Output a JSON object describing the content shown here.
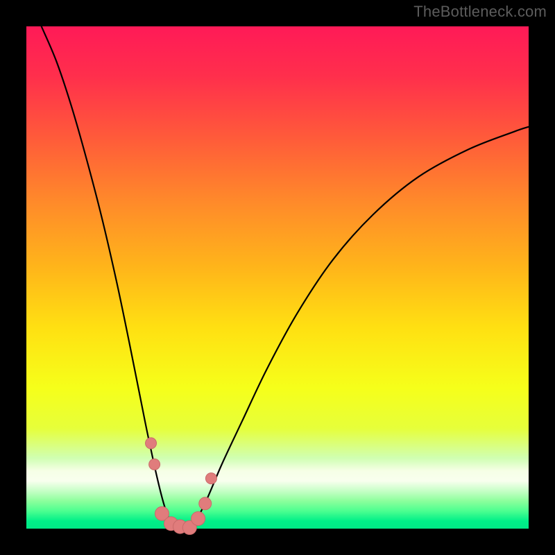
{
  "watermark": "TheBottleneck.com",
  "colors": {
    "frame": "#000000",
    "curve": "#000000",
    "dot_fill": "#e07c7c",
    "dot_stroke": "#c96a6a",
    "gradient_stops": [
      {
        "offset": 0.0,
        "color": "#ff1a57"
      },
      {
        "offset": 0.1,
        "color": "#ff2f4c"
      },
      {
        "offset": 0.22,
        "color": "#ff5a3a"
      },
      {
        "offset": 0.35,
        "color": "#ff8a2a"
      },
      {
        "offset": 0.48,
        "color": "#ffb51a"
      },
      {
        "offset": 0.6,
        "color": "#ffe012"
      },
      {
        "offset": 0.72,
        "color": "#f6ff1a"
      },
      {
        "offset": 0.8,
        "color": "#e6ff3a"
      },
      {
        "offset": 0.86,
        "color": "#d0ffb3"
      },
      {
        "offset": 0.885,
        "color": "#f6ffe6"
      },
      {
        "offset": 0.905,
        "color": "#f8ffee"
      },
      {
        "offset": 0.925,
        "color": "#c6ffc6"
      },
      {
        "offset": 0.945,
        "color": "#8cff9c"
      },
      {
        "offset": 0.965,
        "color": "#4cff90"
      },
      {
        "offset": 0.985,
        "color": "#00ef88"
      },
      {
        "offset": 1.0,
        "color": "#00e886"
      }
    ]
  },
  "chart_data": {
    "type": "line",
    "title": "",
    "xlabel": "",
    "ylabel": "",
    "description": "Two V-shaped bottleneck curves on a red-to-green vertical gradient. Lower y ≈ greener ≈ better. Left curve dips to ~0 near x≈0.28; right curve dips near x≈0.33 then rises shallower than left branch.",
    "xlim": [
      0,
      1
    ],
    "ylim": [
      0,
      1
    ],
    "grid": false,
    "legend": false,
    "series": [
      {
        "name": "left-curve",
        "x": [
          0.03,
          0.06,
          0.09,
          0.12,
          0.15,
          0.18,
          0.205,
          0.225,
          0.24,
          0.255,
          0.268,
          0.278,
          0.286,
          0.293,
          0.3
        ],
        "values": [
          1.0,
          0.93,
          0.84,
          0.735,
          0.62,
          0.49,
          0.37,
          0.27,
          0.195,
          0.125,
          0.07,
          0.035,
          0.015,
          0.003,
          0.0
        ]
      },
      {
        "name": "right-curve",
        "x": [
          0.325,
          0.34,
          0.36,
          0.39,
          0.43,
          0.48,
          0.54,
          0.61,
          0.69,
          0.78,
          0.88,
          0.97,
          1.0
        ],
        "values": [
          0.0,
          0.02,
          0.06,
          0.13,
          0.215,
          0.32,
          0.43,
          0.535,
          0.625,
          0.7,
          0.755,
          0.79,
          0.8
        ]
      }
    ],
    "points": [
      {
        "name": "dot-left-upper",
        "x": 0.248,
        "y": 0.17,
        "r": 8
      },
      {
        "name": "dot-left-lower",
        "x": 0.255,
        "y": 0.128,
        "r": 8
      },
      {
        "name": "dot-bottom-1",
        "x": 0.27,
        "y": 0.03,
        "r": 10
      },
      {
        "name": "dot-bottom-2",
        "x": 0.288,
        "y": 0.01,
        "r": 10
      },
      {
        "name": "dot-bottom-3",
        "x": 0.306,
        "y": 0.004,
        "r": 10
      },
      {
        "name": "dot-bottom-4",
        "x": 0.325,
        "y": 0.002,
        "r": 10
      },
      {
        "name": "dot-bottom-5",
        "x": 0.342,
        "y": 0.02,
        "r": 10
      },
      {
        "name": "dot-bottom-6",
        "x": 0.356,
        "y": 0.05,
        "r": 9
      },
      {
        "name": "dot-right-upper",
        "x": 0.368,
        "y": 0.1,
        "r": 8
      }
    ]
  }
}
